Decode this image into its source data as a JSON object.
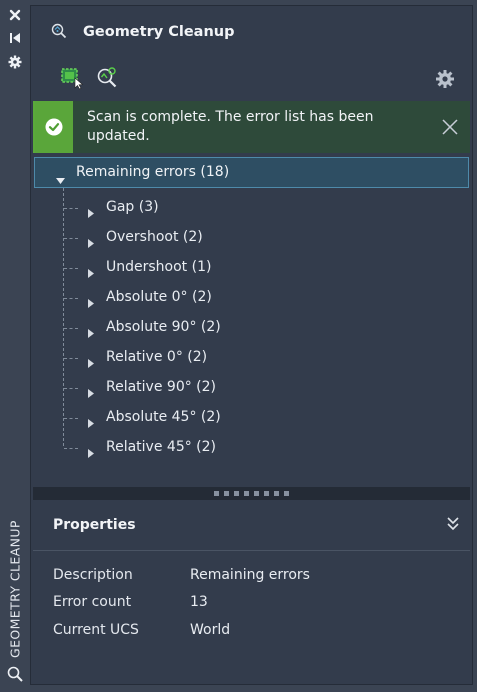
{
  "side_strip": {
    "vertical_label": "GEOMETRY CLEANUP",
    "icons": [
      "close-icon",
      "auto-hide-icon",
      "settings-icon",
      "search-icon"
    ]
  },
  "header": {
    "title": "Geometry Cleanup"
  },
  "toolbar": {
    "buttons": [
      "select-objects-icon",
      "zoom-to-error-icon",
      "settings-icon"
    ]
  },
  "notification": {
    "message": "Scan is complete. The error list has been updated.",
    "status_color": "#5aa63a"
  },
  "tree": {
    "root": "Remaining errors (18)",
    "children": [
      "Gap (3)",
      "Overshoot (2)",
      "Undershoot (1)",
      "Absolute 0° (2)",
      "Absolute 90° (2)",
      "Relative 0° (2)",
      "Relative 90° (2)",
      "Absolute 45° (2)",
      "Relative 45° (2)"
    ]
  },
  "properties": {
    "title": "Properties",
    "rows": [
      {
        "key": "Description",
        "value": "Remaining errors"
      },
      {
        "key": "Error count",
        "value": "13"
      },
      {
        "key": "Current UCS",
        "value": "World"
      }
    ]
  },
  "colors": {
    "accent": "#4e8aaa",
    "success": "#5aa63a",
    "panel_bg": "#333c4c"
  }
}
